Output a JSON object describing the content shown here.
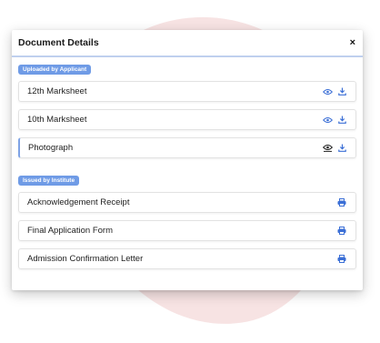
{
  "modal": {
    "title": "Document Details",
    "close_label": "×"
  },
  "sections": [
    {
      "label": "Uploaded by Applicant"
    },
    {
      "label": "Issued by Institute"
    }
  ],
  "uploaded_items": [
    {
      "label": "12th Marksheet"
    },
    {
      "label": "10th Marksheet"
    },
    {
      "label": "Photograph"
    }
  ],
  "issued_items": [
    {
      "label": "Acknowledgement Receipt"
    },
    {
      "label": "Final Application Form"
    },
    {
      "label": "Admission Confirmation Letter"
    }
  ],
  "icons": {
    "view": "eye-icon",
    "download": "download-icon",
    "print": "printer-icon"
  },
  "colors": {
    "accent": "#3b6fd6",
    "badge": "#6f9be6",
    "blob": "#f7e3e3"
  }
}
